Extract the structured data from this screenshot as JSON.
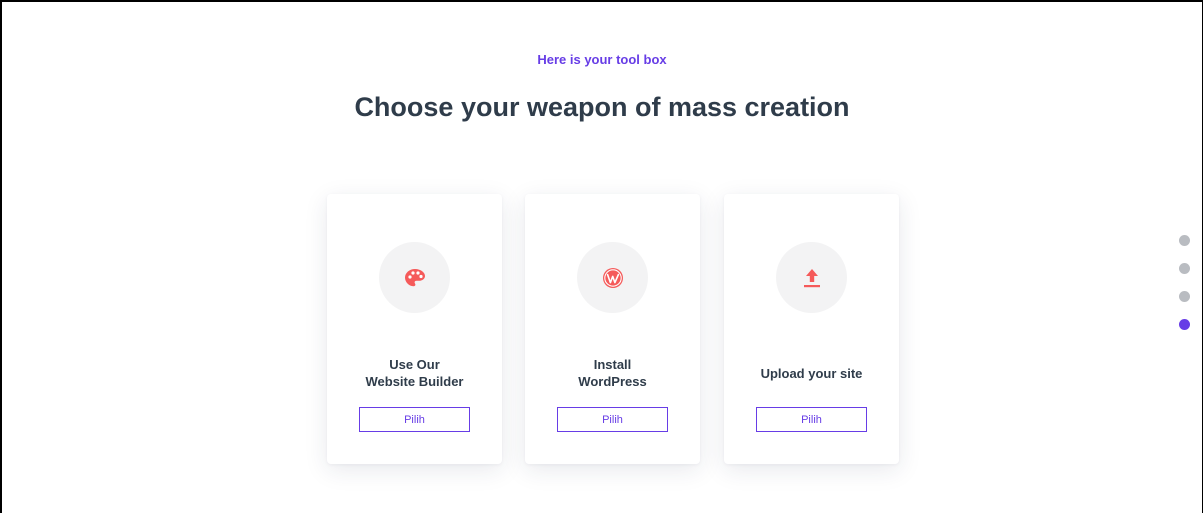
{
  "header": {
    "eyebrow": "Here is your tool box",
    "title": "Choose your weapon of mass creation"
  },
  "cards": [
    {
      "icon": "palette-icon",
      "label_lines": [
        "Use Our",
        "Website Builder"
      ],
      "button": "Pilih"
    },
    {
      "icon": "wordpress-icon",
      "label_lines": [
        "Install",
        "WordPress"
      ],
      "button": "Pilih"
    },
    {
      "icon": "upload-icon",
      "label_lines": [
        "Upload your site"
      ],
      "button": "Pilih"
    }
  ],
  "pagination": {
    "count": 4,
    "active_index": 3
  },
  "colors": {
    "accent": "#673de6",
    "icon": "#f55a5a",
    "heading": "#2f3c4a",
    "dot_inactive": "#b9bcc1"
  }
}
